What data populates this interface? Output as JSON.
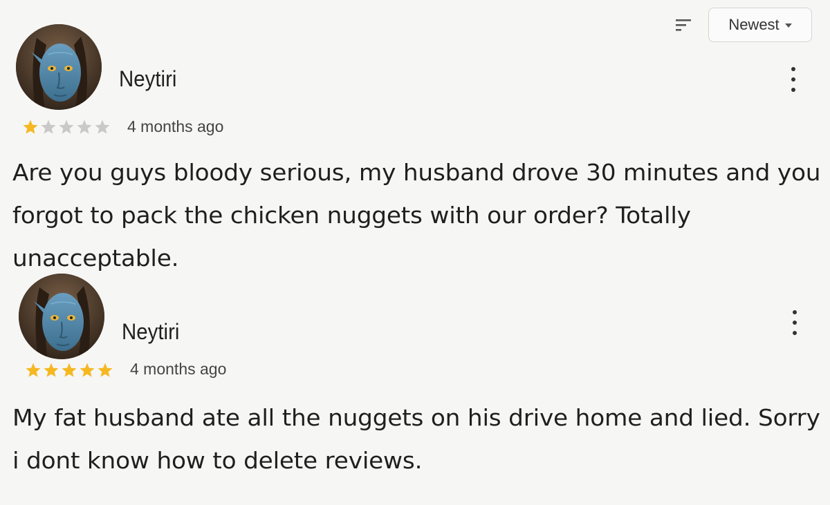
{
  "sort": {
    "selected": "Newest"
  },
  "reviews": [
    {
      "author": "Neytiri",
      "rating": 1,
      "max_rating": 5,
      "date": "4 months ago",
      "text": "Are you guys bloody serious, my husband drove 30 minutes and you forgot to pack the chicken nuggets with our order? Totally unacceptable."
    },
    {
      "author": "Neytiri",
      "rating": 5,
      "max_rating": 5,
      "date": "4 months ago",
      "text": "My fat husband ate all the nuggets on his drive home and lied. Sorry i dont know how to delete reviews."
    }
  ],
  "colors": {
    "star_filled": "#f5b820",
    "star_empty": "#c9c9c9",
    "avatar_skin": "#4f86a8"
  },
  "icons": {
    "sort": "sort-lines-icon",
    "more": "more-vertical-icon",
    "star": "star-icon",
    "caret": "caret-down-icon"
  }
}
